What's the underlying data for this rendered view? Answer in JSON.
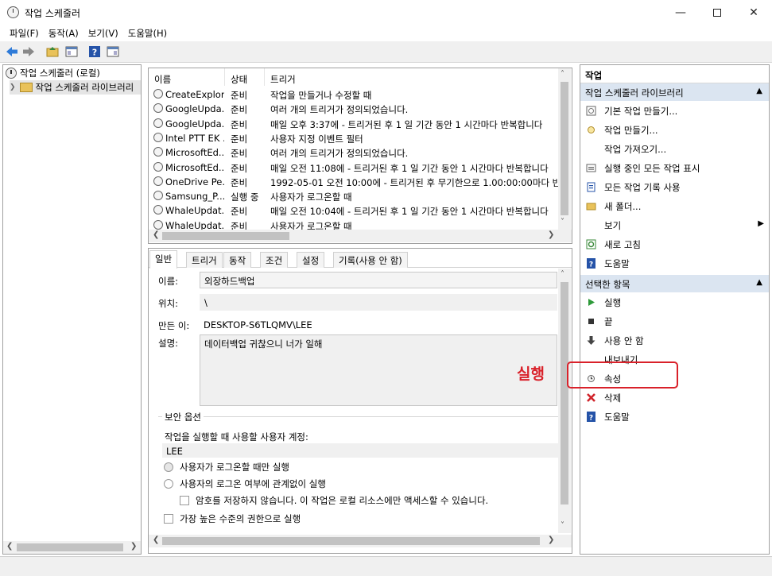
{
  "window": {
    "title": "작업 스케줄러"
  },
  "menu": [
    "파일(F)",
    "동작(A)",
    "보기(V)",
    "도움말(H)"
  ],
  "tree": {
    "root": "작업 스케줄러 (로컬)",
    "child": "작업 스케줄러 라이브러리"
  },
  "tasks": {
    "columns": [
      "이름",
      "상태",
      "트리거"
    ],
    "rows": [
      {
        "name": "CreateExplor...",
        "status": "준비",
        "trigger": "작업을 만들거나 수정할 때"
      },
      {
        "name": "GoogleUpda...",
        "status": "준비",
        "trigger": "여러 개의 트리거가 정의되었습니다."
      },
      {
        "name": "GoogleUpda...",
        "status": "준비",
        "trigger": "매일 오후 3:37에 - 트리거된 후 1 일 기간 동안 1 시간마다 반복합니다"
      },
      {
        "name": "Intel PTT EK ...",
        "status": "준비",
        "trigger": "사용자 지정 이벤트 필터"
      },
      {
        "name": "MicrosoftEd...",
        "status": "준비",
        "trigger": "여러 개의 트리거가 정의되었습니다."
      },
      {
        "name": "MicrosoftEd...",
        "status": "준비",
        "trigger": "매일 오전 11:08에 - 트리거된 후 1 일 기간 동안 1 시간마다 반복합니다"
      },
      {
        "name": "OneDrive Pe...",
        "status": "준비",
        "trigger": "1992-05-01 오전 10:00에 - 트리거된 후 무기한으로 1.00:00:00마다 반"
      },
      {
        "name": "Samsung_P...",
        "status": "실행 중",
        "trigger": "사용자가 로그온할 때"
      },
      {
        "name": "WhaleUpdat...",
        "status": "준비",
        "trigger": "매일 오전 10:04에 - 트리거된 후 1 일 기간 동안 1 시간마다 반복합니다"
      },
      {
        "name": "WhaleUpdat...",
        "status": "준비",
        "trigger": "사용자가 로그온할 때"
      }
    ]
  },
  "detail": {
    "tabs": [
      "일반",
      "트리거",
      "동작",
      "조건",
      "설정",
      "기록(사용 안 함)"
    ],
    "name_label": "이름:",
    "name_value": "외장하드백업",
    "location_label": "위치:",
    "location_value": "\\",
    "author_label": "만든 이:",
    "author_value": "DESKTOP-S6TLQMV\\LEE",
    "desc_label": "설명:",
    "desc_value": "데이터백업 귀찮으니 너가 일해",
    "security_title": "보안 옵션",
    "account_label": "작업을 실행할 때 사용할 사용자 계정:",
    "account_value": "LEE",
    "opt_logon_only": "사용자가 로그온할 때만 실행",
    "opt_always": "사용자의 로그온 여부에 관계없이 실행",
    "opt_nopass": "암호를 저장하지 않습니다. 이 작업은 로컬 리소스에만 액세스할 수 있습니다.",
    "opt_highest": "가장 높은 수준의 권한으로 실행"
  },
  "actions": {
    "title": "작업",
    "section1": "작업 스케줄러 라이브러리",
    "items1": [
      "기본 작업 만들기...",
      "작업 만들기...",
      "작업 가져오기...",
      "실행 중인 모든 작업 표시",
      "모든 작업 기록 사용",
      "새 폴더...",
      "보기",
      "새로 고침",
      "도움말"
    ],
    "section2": "선택한 항목",
    "items2": [
      "실행",
      "끝",
      "사용 안 함",
      "내보내기...",
      "속성",
      "삭제",
      "도움말"
    ]
  },
  "annotation": {
    "label": "실행",
    "color": "#d9212a"
  }
}
